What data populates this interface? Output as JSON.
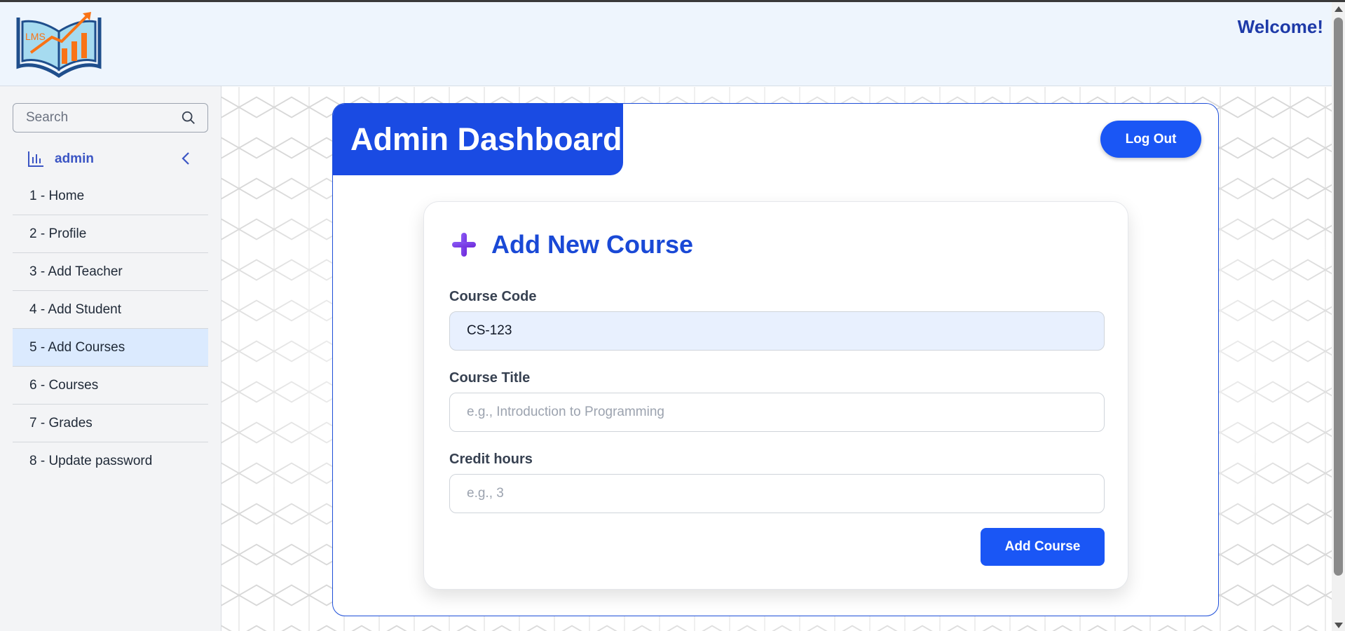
{
  "header": {
    "logo_text": "LMS",
    "welcome": "Welcome!"
  },
  "sidebar": {
    "search_placeholder": "Search",
    "username": "admin",
    "items": [
      {
        "label": "1 - Home"
      },
      {
        "label": "2 - Profile"
      },
      {
        "label": "3 - Add Teacher"
      },
      {
        "label": "4 - Add Student"
      },
      {
        "label": "5 - Add Courses",
        "active": true
      },
      {
        "label": "6 - Courses"
      },
      {
        "label": "7 - Grades"
      },
      {
        "label": "8 - Update password"
      }
    ]
  },
  "dashboard": {
    "title": "Admin Dashboard",
    "logout_label": "Log Out"
  },
  "form": {
    "title": "Add New Course",
    "course_code_label": "Course Code",
    "course_code_value": "CS-123",
    "course_title_label": "Course Title",
    "course_title_placeholder": "e.g., Introduction to Programming",
    "credit_hours_label": "Credit hours",
    "credit_hours_placeholder": "e.g., 3",
    "submit_label": "Add Course"
  },
  "colors": {
    "brand_blue": "#1a4be3",
    "button_blue": "#1a56f5",
    "active_nav_bg": "#dbeafe",
    "logo_orange": "#f97316"
  }
}
